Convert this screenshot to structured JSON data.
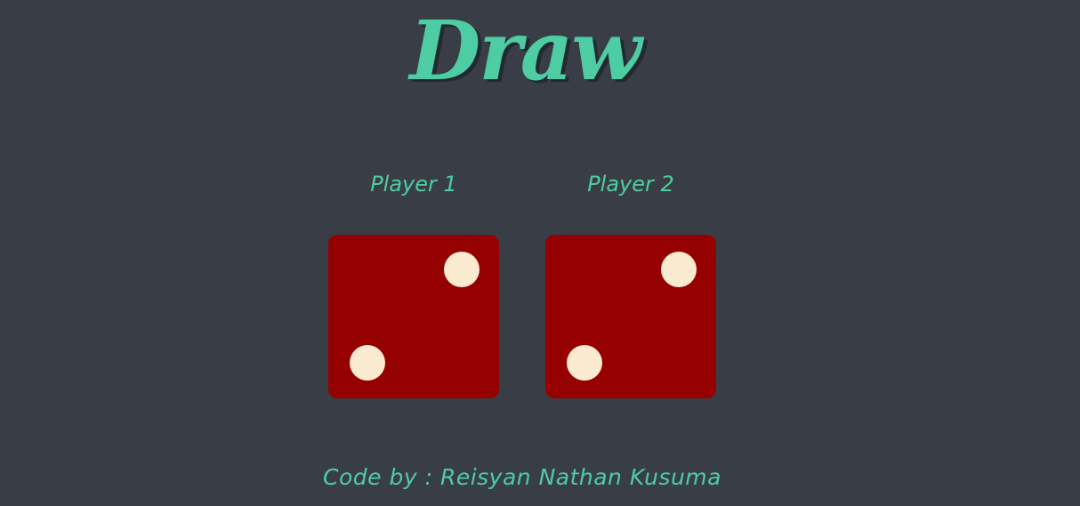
{
  "header": {
    "title": "Draw"
  },
  "players": [
    {
      "label": "Player 1",
      "die_value": 2
    },
    {
      "label": "Player 2",
      "die_value": 2
    }
  ],
  "footer": {
    "credit": "Code by : Reisyan Nathan Kusuma"
  },
  "colors": {
    "background": "#393E46",
    "accent": "#4ECCA3",
    "die": "#950101",
    "pip": "#FAEBD0"
  }
}
